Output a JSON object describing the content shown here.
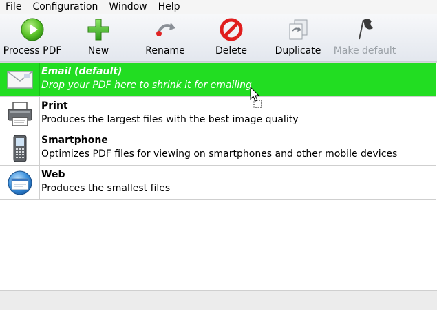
{
  "menu": {
    "items": [
      {
        "label": "File"
      },
      {
        "label": "Configuration"
      },
      {
        "label": "Window"
      },
      {
        "label": "Help"
      }
    ]
  },
  "toolbar": {
    "buttons": [
      {
        "label": "Process PDF",
        "icon": "play-icon",
        "enabled": true
      },
      {
        "label": "New",
        "icon": "plus-icon",
        "enabled": true
      },
      {
        "label": "Rename",
        "icon": "rename-icon",
        "enabled": true
      },
      {
        "label": "Delete",
        "icon": "delete-icon",
        "enabled": true
      },
      {
        "label": "Duplicate",
        "icon": "duplicate-icon",
        "enabled": true
      },
      {
        "label": "Make default",
        "icon": "flag-icon",
        "enabled": false
      }
    ]
  },
  "profiles": [
    {
      "name": "Email (default)",
      "description": "Drop your PDF here to shrink it for emailing",
      "icon": "envelope-icon",
      "selected": true
    },
    {
      "name": "Print",
      "description": "Produces the largest files with the best image quality",
      "icon": "printer-icon",
      "selected": false
    },
    {
      "name": "Smartphone",
      "description": "Optimizes PDF files for viewing on smartphones and other mobile devices",
      "icon": "smartphone-icon",
      "selected": false
    },
    {
      "name": "Web",
      "description": "Produces the smallest files",
      "icon": "globe-icon",
      "selected": false
    }
  ],
  "colors": {
    "selected_row": "#22dd22",
    "selected_text": "#ffffff",
    "disabled_text": "#9aa0a6"
  }
}
